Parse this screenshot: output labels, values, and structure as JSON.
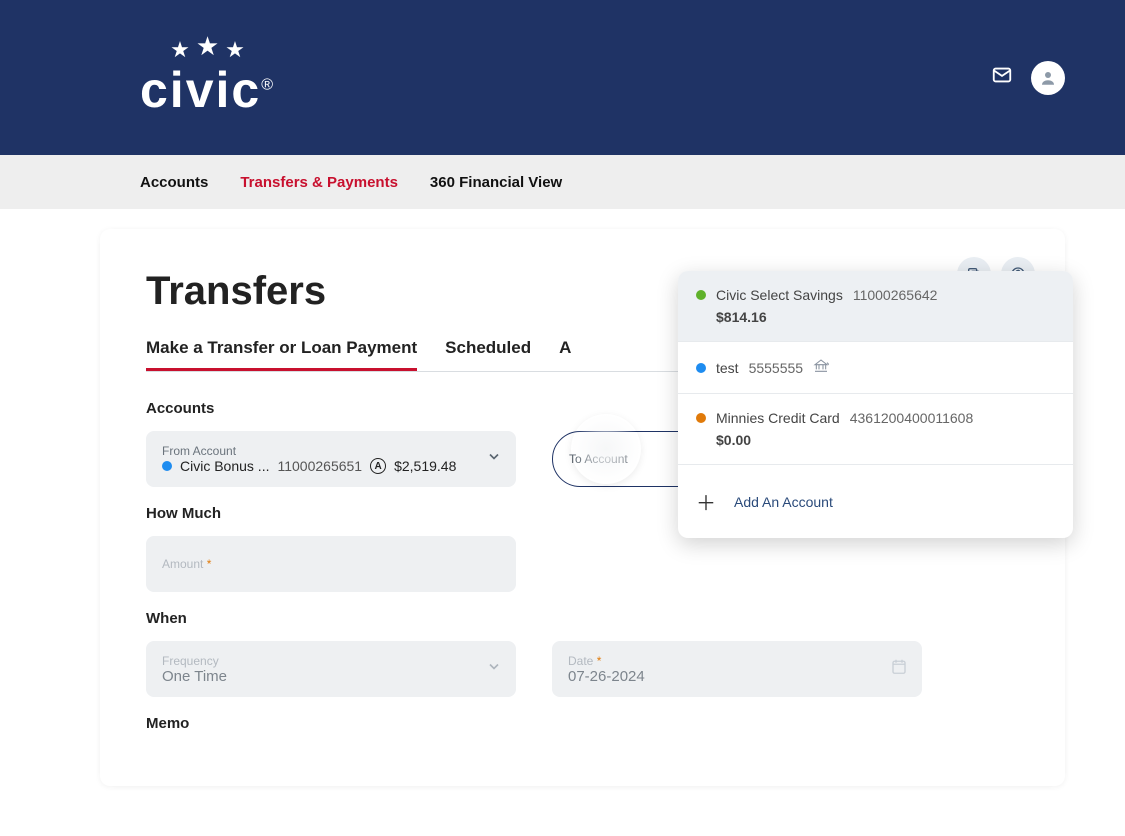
{
  "brand": "civic",
  "nav": {
    "items": [
      {
        "label": "Accounts",
        "active": false
      },
      {
        "label": "Transfers & Payments",
        "active": true
      },
      {
        "label": "360 Financial View",
        "active": false
      }
    ]
  },
  "page": {
    "title": "Transfers",
    "tabs": [
      {
        "label": "Make a Transfer or Loan Payment",
        "active": true
      },
      {
        "label": "Scheduled",
        "active": false
      },
      {
        "label": "A",
        "active": false
      }
    ]
  },
  "sections": {
    "accounts_label": "Accounts",
    "how_much_label": "How Much",
    "when_label": "When",
    "memo_label": "Memo"
  },
  "from_account": {
    "label": "From Account",
    "name": "Civic Bonus ...",
    "number": "11000265651",
    "balance": "$2,519.48"
  },
  "to_account": {
    "label": "To Account"
  },
  "amount_field": {
    "label": "Amount"
  },
  "frequency_field": {
    "label": "Frequency",
    "value": "One Time"
  },
  "date_field": {
    "label": "Date",
    "value": "07-26-2024"
  },
  "dropdown": {
    "add_label": "Add An Account",
    "options": [
      {
        "dot": "green",
        "name": "Civic Select Savings",
        "number": "11000265642",
        "amount": "$814.16",
        "selected": true,
        "ext": false
      },
      {
        "dot": "blue",
        "name": "test",
        "number": "5555555",
        "amount": null,
        "selected": false,
        "ext": true
      },
      {
        "dot": "orange",
        "name": "Minnies Credit Card",
        "number": "4361200400011608",
        "amount": "$0.00",
        "selected": false,
        "ext": false
      }
    ]
  }
}
